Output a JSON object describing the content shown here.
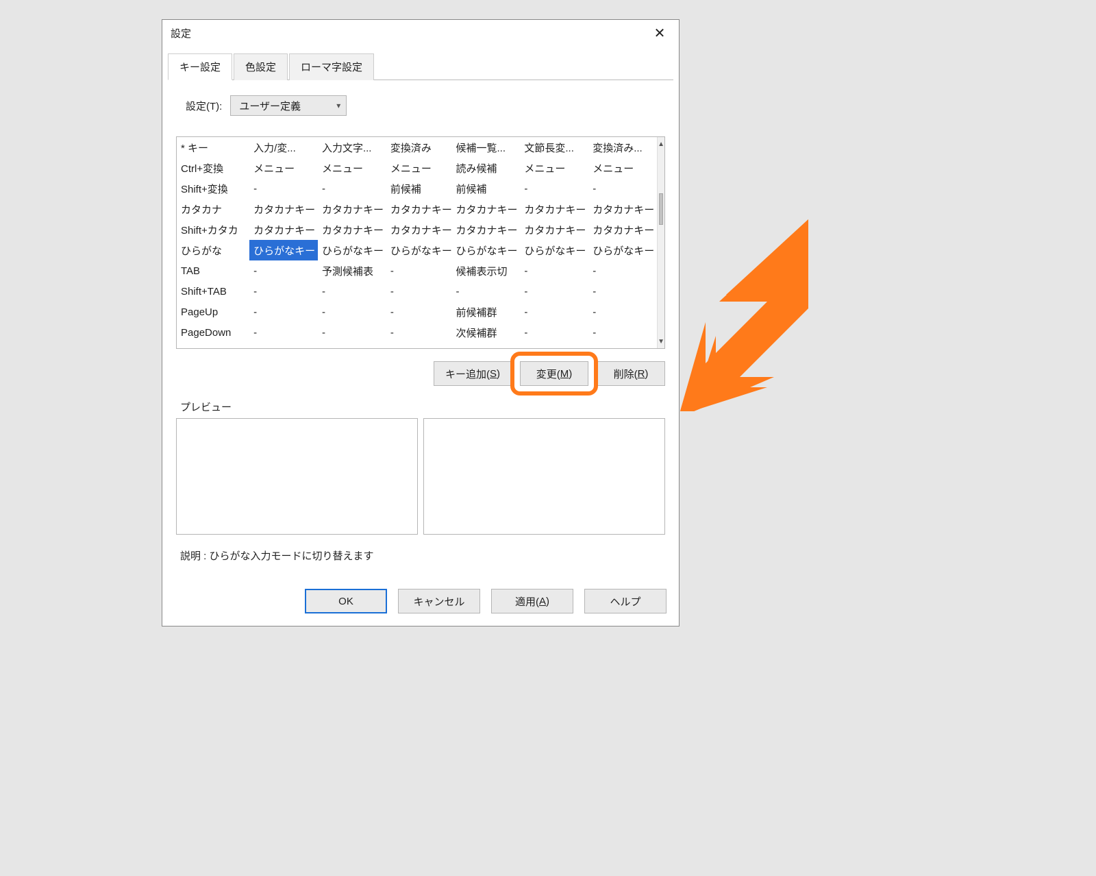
{
  "window": {
    "title": "設定",
    "close_icon": "✕"
  },
  "tabs": [
    {
      "label": "キー設定",
      "active": true
    },
    {
      "label": "色設定",
      "active": false
    },
    {
      "label": "ローマ字設定",
      "active": false
    }
  ],
  "settings": {
    "label": "設定(T):",
    "label_underline_char": "T",
    "combo": {
      "value": "ユーザー定義"
    }
  },
  "table": {
    "columns": [
      "* キー",
      "入力/変...",
      "入力文字...",
      "変換済み",
      "候補一覧...",
      "文節長変...",
      "変換済み..."
    ],
    "rows": [
      {
        "key": "Ctrl+変換",
        "cells": [
          "メニュー",
          "メニュー",
          "メニュー",
          "読み候補",
          "メニュー",
          "メニュー"
        ],
        "selected_col": null
      },
      {
        "key": "Shift+変換",
        "cells": [
          "-",
          "-",
          "前候補",
          "前候補",
          "-",
          "-"
        ],
        "selected_col": null
      },
      {
        "key": "カタカナ",
        "cells": [
          "カタカナキー",
          "カタカナキー",
          "カタカナキー",
          "カタカナキー",
          "カタカナキー",
          "カタカナキー"
        ],
        "selected_col": null
      },
      {
        "key": "Shift+カタカ",
        "cells": [
          "カタカナキー",
          "カタカナキー",
          "カタカナキー",
          "カタカナキー",
          "カタカナキー",
          "カタカナキー"
        ],
        "selected_col": null
      },
      {
        "key": "ひらがな",
        "cells": [
          "ひらがなキー",
          "ひらがなキー",
          "ひらがなキー",
          "ひらがなキー",
          "ひらがなキー",
          "ひらがなキー"
        ],
        "selected_col": 0
      },
      {
        "key": "TAB",
        "cells": [
          "-",
          "予測候補表",
          "-",
          "候補表示切",
          "-",
          "-"
        ],
        "selected_col": null
      },
      {
        "key": "Shift+TAB",
        "cells": [
          "-",
          "-",
          "-",
          "-",
          "-",
          "-"
        ],
        "selected_col": null
      },
      {
        "key": "PageUp",
        "cells": [
          "-",
          "-",
          "-",
          "前候補群",
          "-",
          "-"
        ],
        "selected_col": null
      },
      {
        "key": "PageDown",
        "cells": [
          "-",
          "-",
          "-",
          "次候補群",
          "-",
          "-"
        ],
        "selected_col": null
      }
    ]
  },
  "table_buttons": {
    "add": {
      "text": "キー追加(",
      "u": "S",
      "suffix": ")"
    },
    "modify": {
      "text": "変更(",
      "u": "M",
      "suffix": ")",
      "highlighted": true
    },
    "delete": {
      "text": "削除(",
      "u": "R",
      "suffix": ")"
    }
  },
  "preview": {
    "label": "プレビュー"
  },
  "description": "説明   :  ひらがな入力モードに切り替えます",
  "bottom_buttons": {
    "ok": {
      "text": "OK",
      "default": true
    },
    "cancel": {
      "text": "キャンセル"
    },
    "apply": {
      "text": "適用(",
      "u": "A",
      "suffix": ")"
    },
    "help": {
      "text": "ヘルプ"
    }
  },
  "annotation": {
    "arrow_color": "#ff7a1a"
  }
}
